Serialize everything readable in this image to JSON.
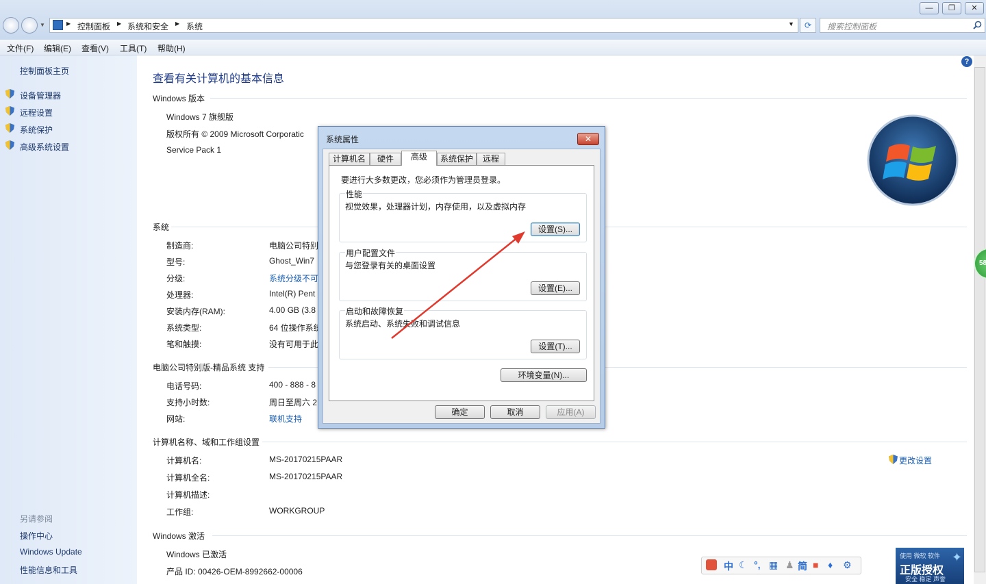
{
  "address_bar": {
    "breadcrumb": [
      "控制面板",
      "系统和安全",
      "系统"
    ],
    "search_placeholder": "搜索控制面板"
  },
  "window_buttons": {
    "minimize": "—",
    "restore": "❐",
    "close": "✕"
  },
  "menu": [
    "文件(F)",
    "编辑(E)",
    "查看(V)",
    "工具(T)",
    "帮助(H)"
  ],
  "left_panel": {
    "home": "控制面板主页",
    "tasks": [
      "设备管理器",
      "远程设置",
      "系统保护",
      "高级系统设置"
    ],
    "see_also_title": "另请参阅",
    "see_also": [
      "操作中心",
      "Windows Update",
      "性能信息和工具"
    ]
  },
  "main": {
    "page_title": "查看有关计算机的基本信息",
    "windows_edition": {
      "heading": "Windows 版本",
      "edition": "Windows 7 旗舰版",
      "copyright": "版权所有 © 2009 Microsoft Corporatic",
      "service_pack": "Service Pack 1"
    },
    "system": {
      "heading": "系统",
      "rows": [
        {
          "label": "制造商:",
          "value": "电脑公司特别"
        },
        {
          "label": "型号:",
          "value": "Ghost_Win7"
        },
        {
          "label": "分级:",
          "value": "系统分级不可"
        },
        {
          "label": "处理器:",
          "value": "Intel(R) Pent"
        },
        {
          "label": "安装内存(RAM):",
          "value": "4.00 GB (3.8"
        },
        {
          "label": "系统类型:",
          "value": "64 位操作系统"
        },
        {
          "label": "笔和触摸:",
          "value": "没有可用于此"
        }
      ]
    },
    "support": {
      "heading": "电脑公司特别版-精品系统 支持",
      "rows": [
        {
          "label": "电话号码:",
          "value": "400 - 888 - 8"
        },
        {
          "label": "支持小时数:",
          "value": "周日至周六  2"
        },
        {
          "label": "网站:",
          "value": "联机支持"
        }
      ]
    },
    "computer_name": {
      "heading": "计算机名称、域和工作组设置",
      "change_settings": "更改设置",
      "rows": [
        {
          "label": "计算机名:",
          "value": "MS-20170215PAAR"
        },
        {
          "label": "计算机全名:",
          "value": "MS-20170215PAAR"
        },
        {
          "label": "计算机描述:",
          "value": ""
        },
        {
          "label": "工作组:",
          "value": "WORKGROUP"
        }
      ]
    },
    "activation": {
      "heading": "Windows 激活",
      "status": "Windows 已激活",
      "product_id": "产品 ID: 00426-OEM-8992662-00006"
    }
  },
  "dialog": {
    "title": "系统属性",
    "close": "✕",
    "tabs": [
      "计算机名",
      "硬件",
      "高级",
      "系统保护",
      "远程"
    ],
    "active_tab": "高级",
    "admin_note": "要进行大多数更改，您必须作为管理员登录。",
    "performance": {
      "title": "性能",
      "desc": "视觉效果，处理器计划，内存使用，以及虚拟内存",
      "button": "设置(S)..."
    },
    "user_profiles": {
      "title": "用户配置文件",
      "desc": "与您登录有关的桌面设置",
      "button": "设置(E)..."
    },
    "startup_recovery": {
      "title": "启动和故障恢复",
      "desc": "系统启动、系统失败和调试信息",
      "button": "设置(T)..."
    },
    "env_button": "环境变量(N)...",
    "ok": "确定",
    "cancel": "取消",
    "apply": "应用(A)"
  },
  "ime_bar": [
    "中",
    "简"
  ],
  "genuine_badge": {
    "small": "使用 微软 软件",
    "big": "正版授权",
    "sub": "安全 稳定 声誉"
  },
  "side_badge": "58",
  "colors": {
    "link": "#1a5fb4",
    "arrow": "#e03a2f",
    "left_panel_bg": "#dfe9f7"
  }
}
